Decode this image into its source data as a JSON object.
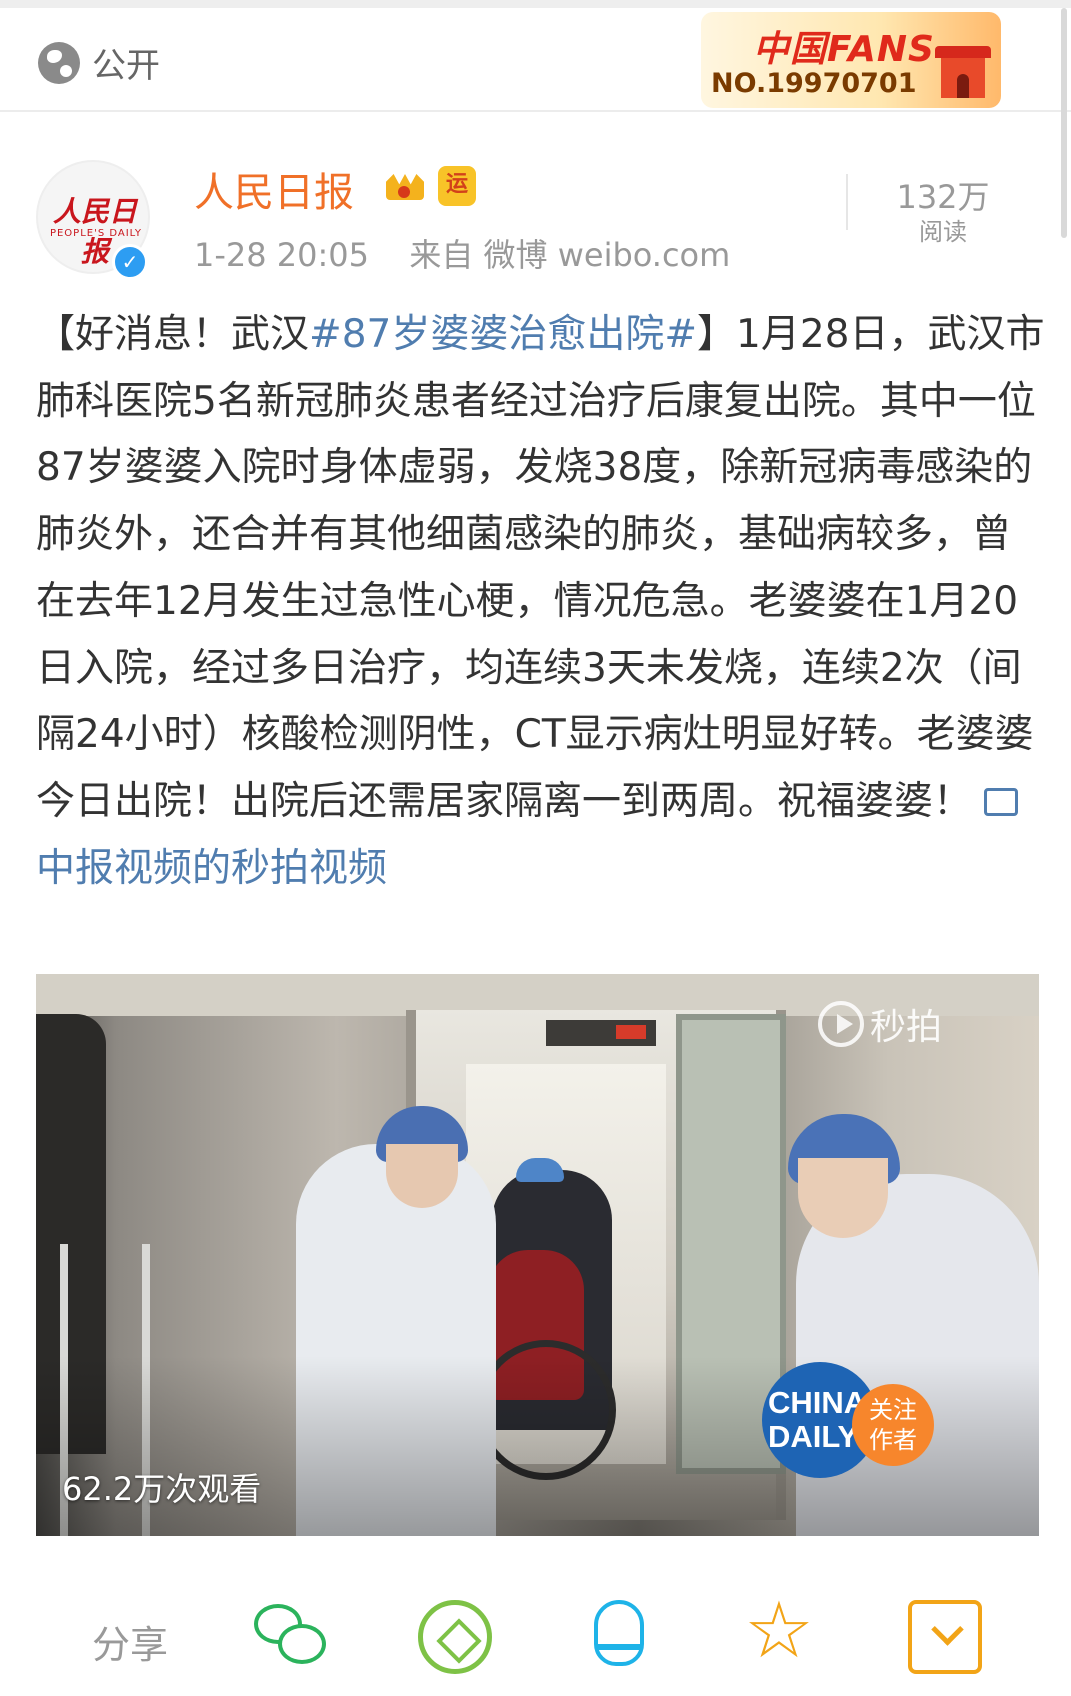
{
  "top_bar": {
    "visibility_label": "公开",
    "visibility_icon": "globe-icon",
    "fans_badge": {
      "title": "中国FANS",
      "number": "NO.19970701"
    }
  },
  "post": {
    "author": {
      "name": "人民日报",
      "avatar_text": "人民日报",
      "avatar_subtext": "PEOPLE'S DAILY",
      "verified_icon": "verified-icon",
      "badges": [
        "crown-icon",
        "yun-badge-icon"
      ],
      "yun_badge_text": "运"
    },
    "meta": {
      "time": "1-28 20:05",
      "source": "来自 微博 weibo.com"
    },
    "reads": {
      "count": "132万",
      "label": "阅读"
    },
    "text": {
      "prefix": "【好消息！武汉",
      "hashtag": "#87岁婆婆治愈出院#",
      "body": "】1月28日，武汉市肺科医院5名新冠肺炎患者经过治疗后康复出院。其中一位87岁婆婆入院时身体虚弱，发烧38度，除新冠病毒感染的肺炎外，还合并有其他细菌感染的肺炎，基础病较多，曾在去年12月发生过急性心梗，情况危急。老婆婆在1月20日入院，经过多日治疗，均连续3天未发烧，连续2次（间隔24小时）核酸检测阴性，CT显示病灶明显好转。老婆婆今日出院！出院后还需居家隔离一到两周。祝福婆婆！",
      "video_link": "中报视频的秒拍视频"
    },
    "video": {
      "platform_label": "秒拍",
      "view_count": "62.2万次观看",
      "channel_logo": "CHINA DAILY",
      "follow_line1": "关注",
      "follow_line2": "作者"
    }
  },
  "share_bar": {
    "label": "分享",
    "targets": [
      "wechat-icon",
      "moments-icon",
      "qq-icon",
      "favorite-icon",
      "download-icon"
    ]
  },
  "colors": {
    "author_name": "#f07028",
    "link": "#507daf",
    "verified": "#2d9df2",
    "follow": "#f7862c"
  }
}
